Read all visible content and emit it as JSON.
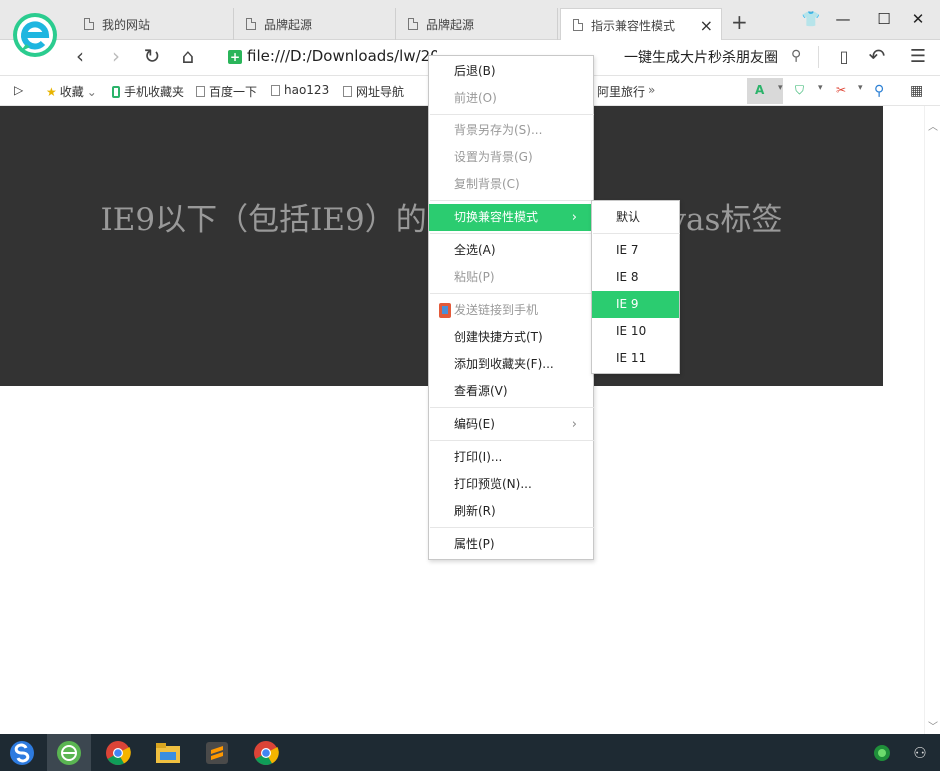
{
  "tabs": [
    {
      "label": "我的网站",
      "active": false
    },
    {
      "label": "品牌起源",
      "active": false
    },
    {
      "label": "品牌起源",
      "active": false
    },
    {
      "label": "指示兼容性模式",
      "active": true
    }
  ],
  "tab_close": "×",
  "new_tab": "+",
  "window_controls": {
    "skin": "👕",
    "minimize": "—",
    "maximize": "☐",
    "close": "✕"
  },
  "nav": {
    "back": "‹",
    "forward": "›",
    "refresh": "↻",
    "home": "⌂",
    "menu": "☰",
    "undo": "↶"
  },
  "address": {
    "secure_badge": "+",
    "url": "file:///D:/Downloads/lw/2019052…"
  },
  "search": {
    "text": "一键生成大片秒杀朋友圈",
    "icon": "⚲"
  },
  "bookmarks": [
    "收藏",
    "手机收藏夹",
    "百度一下",
    "hao123",
    "网址导航",
    "阿里旅行"
  ],
  "bookmarks_more": "»",
  "page": {
    "heading": "IE9以下（包括IE9）的浏览器不支持canvas标签"
  },
  "context_menu": {
    "items": [
      {
        "label": "后退(B)",
        "disabled": false
      },
      {
        "label": "前进(O)",
        "disabled": true
      },
      {
        "label": "背景另存为(S)...",
        "disabled": true
      },
      {
        "label": "设置为背景(G)",
        "disabled": true
      },
      {
        "label": "复制背景(C)",
        "disabled": true
      },
      {
        "label": "切换兼容性模式",
        "disabled": false,
        "highlighted": true,
        "submenu": true
      },
      {
        "label": "全选(A)",
        "disabled": false
      },
      {
        "label": "粘贴(P)",
        "disabled": true
      },
      {
        "label": "发送链接到手机",
        "disabled": true,
        "icon": "phone-icon"
      },
      {
        "label": "创建快捷方式(T)",
        "disabled": false
      },
      {
        "label": "添加到收藏夹(F)...",
        "disabled": false
      },
      {
        "label": "查看源(V)",
        "disabled": false
      },
      {
        "label": "编码(E)",
        "disabled": false,
        "submenu": true
      },
      {
        "label": "打印(I)...",
        "disabled": false
      },
      {
        "label": "打印预览(N)...",
        "disabled": false
      },
      {
        "label": "刷新(R)",
        "disabled": false
      },
      {
        "label": "属性(P)",
        "disabled": false
      }
    ],
    "arrow": "›"
  },
  "compat_submenu": {
    "items": [
      "默认",
      "IE 7",
      "IE 8",
      "IE 9",
      "IE 10",
      "IE 11"
    ],
    "selected": "IE 9"
  },
  "colors": {
    "accent": "#2bcc70",
    "page_bg": "#333333",
    "heading": "#999999",
    "taskbar": "#1e2a33"
  }
}
